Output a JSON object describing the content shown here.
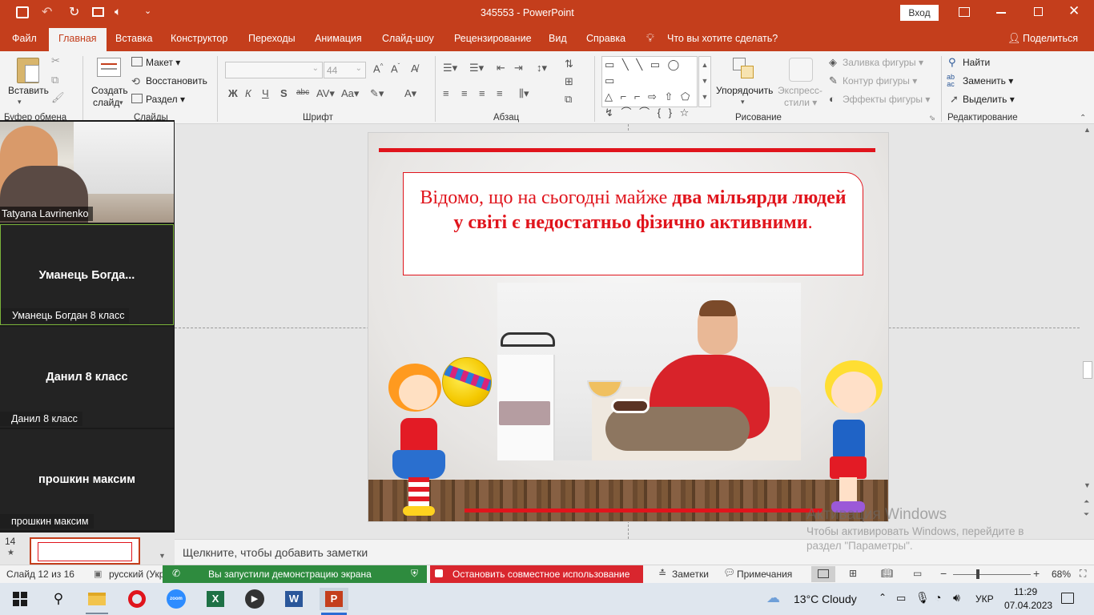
{
  "window": {
    "doc_title": "345553",
    "app_name": "PowerPoint",
    "sign_in": "Вход"
  },
  "menu": {
    "tabs": [
      "Файл",
      "Главная",
      "Вставка",
      "Конструктор",
      "Переходы",
      "Анимация",
      "Слайд-шоу",
      "Рецензирование",
      "Вид",
      "Справка"
    ],
    "tell_me": "Что вы хотите сделать?",
    "share": "Поделиться"
  },
  "ribbon": {
    "paste": "Вставить",
    "create_slide_1": "Создать",
    "create_slide_2": "слайд",
    "layout": "Макет",
    "reset": "Восстановить",
    "section": "Раздел",
    "font_size": "44",
    "groups": {
      "clipboard": "Буфер обмена",
      "slides": "Слайды",
      "font": "Шрифт",
      "paragraph": "Абзац",
      "drawing": "Рисование",
      "editing": "Редактирование"
    },
    "arrange": "Упорядочить",
    "quick_styles_1": "Экспресс-",
    "quick_styles_2": "стили",
    "shape_fill": "Заливка фигуры",
    "shape_outline": "Контур фигуры",
    "shape_effects": "Эффекты фигуры",
    "find": "Найти",
    "replace": "Заменить",
    "select": "Выделить"
  },
  "zoom_participants": [
    {
      "name_big": "",
      "label": "Tatyana Lavrinenko",
      "video": true,
      "muted": false
    },
    {
      "name_big": "Уманець  Богда...",
      "label": "Уманець Богдан 8 класс",
      "video": false,
      "muted": true
    },
    {
      "name_big": "Данил 8 класс",
      "label": "Данил 8 класс",
      "video": false,
      "muted": true
    },
    {
      "name_big": "прошкин максим",
      "label": "прошкин максим",
      "video": false,
      "muted": true
    }
  ],
  "thumbnail": {
    "number": "14",
    "star": "★"
  },
  "slide": {
    "text_normal": "Відомо, що на сьогодні майже ",
    "text_bold": "два мільярди людей у світі є недостатньо фізично активними",
    "text_end": "."
  },
  "notes": {
    "placeholder": "Щелкните, чтобы добавить заметки"
  },
  "watermark": {
    "line1": "Активация Windows",
    "line2": "Чтобы активировать Windows, перейдите в",
    "line3": "раздел \"Параметры\"."
  },
  "status": {
    "slide_info": "Слайд 12 из 16",
    "language": "русский (Укр",
    "sharing": "Вы запустили демонстрацию экрана",
    "stop_sharing": "Остановить совместное использование",
    "notes_btn": "Заметки",
    "comments_btn": "Примечания",
    "zoom_minus": "−",
    "zoom_plus": "+",
    "zoom_level": "68%",
    "zoom_level_value": 68
  },
  "taskbar": {
    "weather": "13°C  Cloudy",
    "lang": "УКР",
    "time": "11:29",
    "date": "07.04.2023",
    "apps": [
      "file-explorer-icon",
      "opera-icon",
      "zoom-icon",
      "excel-icon",
      "media-player-icon",
      "word-icon",
      "powerpoint-icon"
    ]
  },
  "colors": {
    "accent": "#c43e1c",
    "slide_text_red": "#e0141c",
    "zoom_green": "#2e8b3e",
    "zoom_stop_red": "#d9262e"
  }
}
